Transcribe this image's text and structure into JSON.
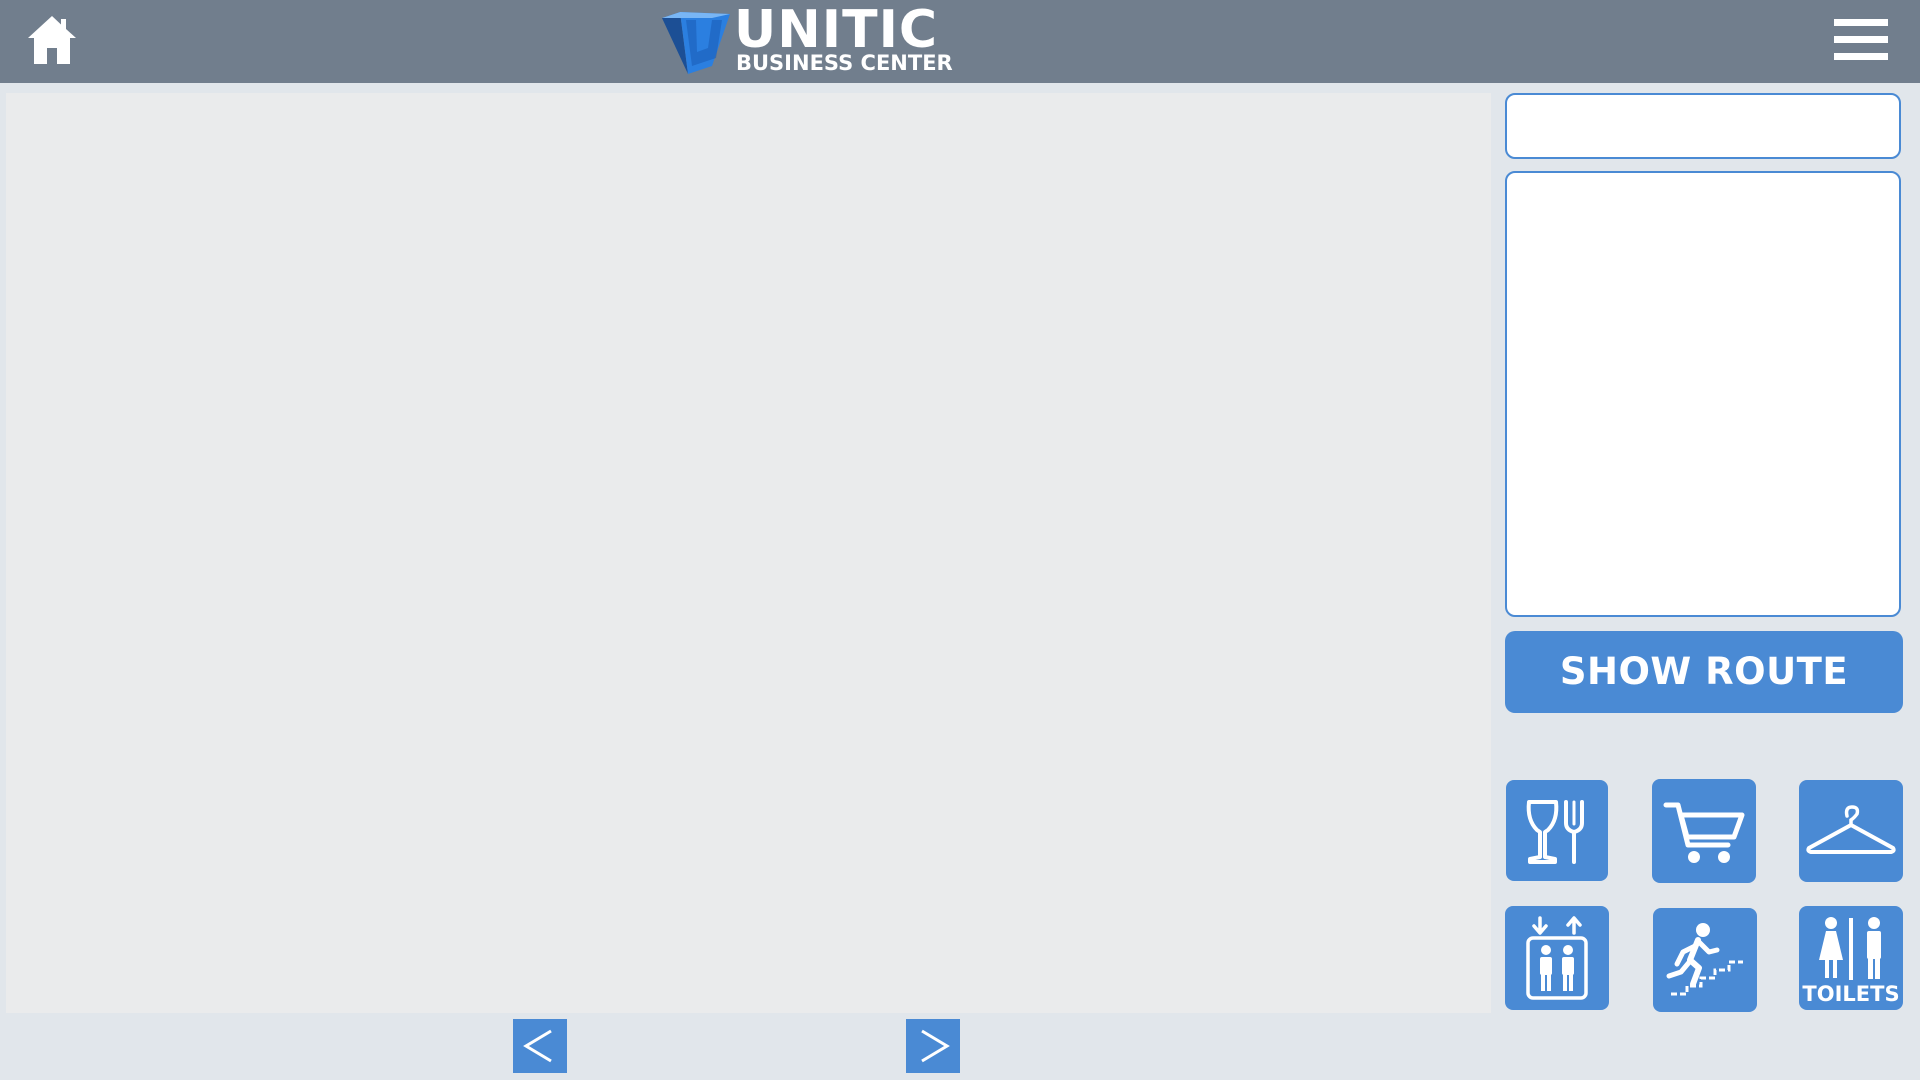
{
  "header": {
    "brand_name": "UNITIC",
    "brand_tagline": "BUSINESS CENTER",
    "home_icon": "home-icon",
    "menu_icon": "hamburger-menu-icon"
  },
  "search": {
    "value": "",
    "placeholder": ""
  },
  "results": {
    "items": []
  },
  "actions": {
    "show_route_label": "SHOW ROUTE"
  },
  "pager": {
    "prev_icon": "chevron-left-icon",
    "next_icon": "chevron-right-icon"
  },
  "categories": [
    {
      "id": "restaurants",
      "icon": "restaurant-icon"
    },
    {
      "id": "shopping",
      "icon": "shopping-cart-icon"
    },
    {
      "id": "clothing",
      "icon": "hanger-icon"
    },
    {
      "id": "elevator",
      "icon": "elevator-icon"
    },
    {
      "id": "stairs",
      "icon": "stairs-icon"
    },
    {
      "id": "toilets",
      "icon": "toilets-icon",
      "label": "TOILETS"
    }
  ],
  "colors": {
    "accent": "#4a8ad4",
    "topbar": "#717e8d",
    "background": "#e1e6eb",
    "map_background": "#eaebec",
    "logo_blue": "#1f6fd0"
  }
}
